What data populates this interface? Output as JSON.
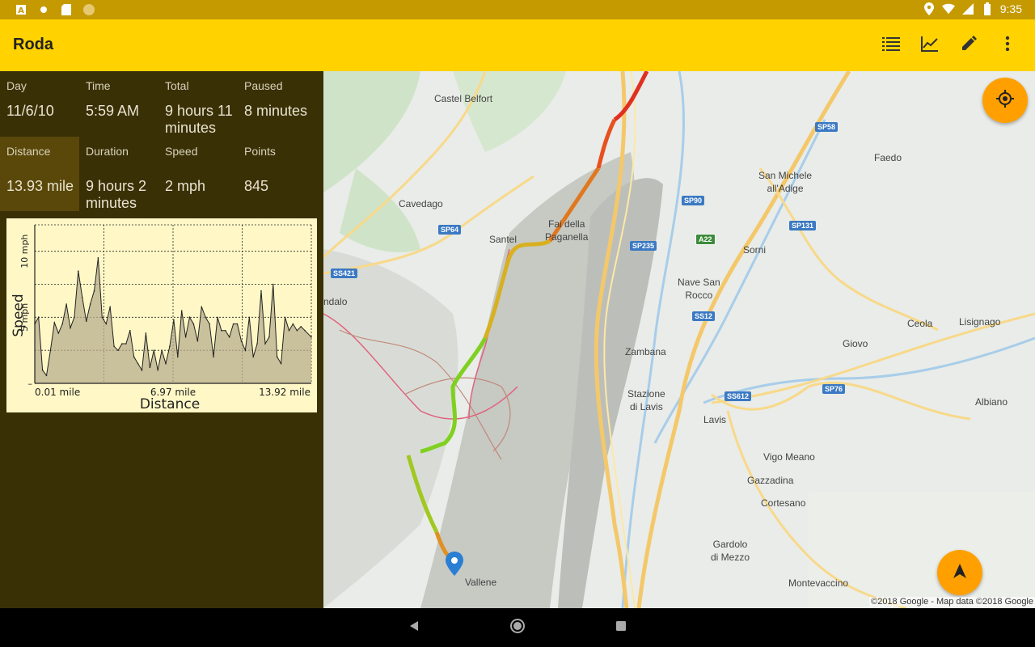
{
  "status_bar": {
    "time": "9:35",
    "left_icons": [
      "app-a-icon",
      "dot-icon",
      "sd-card-icon",
      "circle-icon"
    ],
    "right_icons": [
      "location-icon",
      "wifi-icon",
      "signal-icon",
      "battery-icon"
    ]
  },
  "app_bar": {
    "title": "Roda",
    "actions": [
      "list-icon",
      "chart-icon",
      "edit-icon",
      "more-icon"
    ]
  },
  "stats": {
    "day": {
      "label": "Day",
      "value": "11/6/10"
    },
    "time": {
      "label": "Time",
      "value": "5:59 AM"
    },
    "total": {
      "label": "Total",
      "value": "9 hours 11 minutes"
    },
    "paused": {
      "label": "Paused",
      "value": "8 minutes"
    },
    "distance": {
      "label": "Distance",
      "value": "13.93 mile"
    },
    "duration": {
      "label": "Duration",
      "value": "9 hours 2 minutes"
    },
    "speed": {
      "label": "Speed",
      "value": "2 mph"
    },
    "points": {
      "label": "Points",
      "value": "845"
    }
  },
  "chart_data": {
    "type": "area",
    "xlabel": "Distance",
    "ylabel": "Speed",
    "x_tick_labels": [
      "0.01 mile",
      "6.97 mile",
      "13.92 mile"
    ],
    "y_tick_labels": [
      "5 mph",
      "10 mph"
    ],
    "xlim": [
      0.01,
      13.92
    ],
    "ylim": [
      0,
      12
    ],
    "grid": true,
    "x": [
      0.01,
      0.2,
      0.4,
      0.6,
      0.8,
      1.0,
      1.2,
      1.4,
      1.6,
      1.8,
      2.0,
      2.2,
      2.4,
      2.6,
      2.8,
      3.0,
      3.2,
      3.4,
      3.6,
      3.8,
      4.0,
      4.2,
      4.4,
      4.6,
      4.8,
      5.0,
      5.2,
      5.4,
      5.6,
      5.8,
      6.0,
      6.2,
      6.4,
      6.6,
      6.8,
      7.0,
      7.2,
      7.4,
      7.6,
      7.8,
      8.0,
      8.2,
      8.4,
      8.6,
      8.8,
      9.0,
      9.2,
      9.4,
      9.6,
      9.8,
      10.0,
      10.2,
      10.4,
      10.6,
      10.8,
      11.0,
      11.2,
      11.4,
      11.6,
      11.8,
      12.0,
      12.2,
      12.4,
      12.6,
      12.8,
      13.0,
      13.2,
      13.4,
      13.6,
      13.92
    ],
    "values": [
      4.5,
      5.0,
      1.0,
      0.6,
      2.5,
      4.6,
      3.8,
      4.5,
      6.0,
      4.2,
      5.0,
      8.5,
      6.5,
      4.7,
      6.0,
      7.0,
      9.5,
      5.0,
      4.5,
      5.8,
      2.8,
      2.5,
      3.0,
      3.0,
      4.0,
      2.0,
      1.5,
      1.0,
      3.8,
      1.2,
      2.5,
      1.0,
      2.5,
      1.5,
      2.8,
      4.8,
      2.0,
      5.5,
      3.5,
      5.0,
      4.5,
      3.2,
      5.8,
      5.0,
      4.5,
      2.0,
      5.0,
      4.0,
      4.0,
      3.5,
      4.5,
      4.5,
      3.2,
      2.5,
      5.0,
      2.0,
      3.0,
      7.0,
      3.0,
      3.5,
      7.5,
      2.0,
      1.5,
      5.0,
      4.0,
      4.5,
      4.0,
      4.3,
      4.0,
      3.5
    ]
  },
  "map": {
    "copyright": "©2018 Google - Map data ©2018 Google",
    "places": [
      "Castel Belfort",
      "Faedo",
      "San Michele\nall'Adige",
      "Cavedago",
      "Fai della\nPaganella",
      "Santel",
      "Sorni",
      "Nave San\nRocco",
      "ndalo",
      "Zambana",
      "Ceola",
      "Lisignago",
      "Giovo",
      "Stazione\ndi Lavis",
      "Lavis",
      "Albiano",
      "Vigo Meano",
      "Gazzadina",
      "Cortesano",
      "Gardolo\ndi Mezzo",
      "Vallene",
      "Montevaccino"
    ],
    "shields": [
      "SP58",
      "SP90",
      "SP131",
      "SP64",
      "SP235",
      "A22",
      "SS421",
      "SS12",
      "SS612",
      "SP76"
    ]
  },
  "colors": {
    "status_bar": "#c49a00",
    "app_bar": "#ffd200",
    "panel": "#3a3006",
    "fab": "#ffa000",
    "chart_bg": "#fff8c6"
  }
}
